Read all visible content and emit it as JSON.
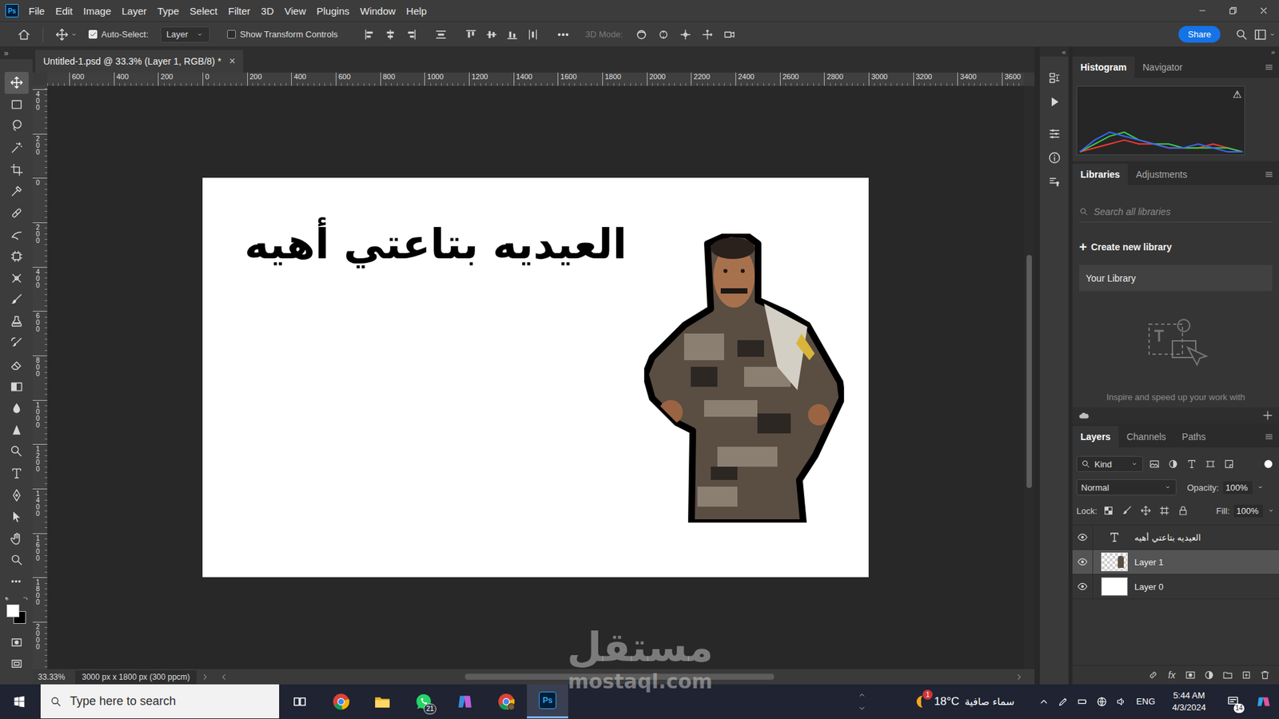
{
  "window": {
    "logo": "Ps",
    "controls": [
      {
        "kind": "minimize"
      },
      {
        "kind": "restore"
      },
      {
        "kind": "close"
      }
    ]
  },
  "menu": [
    "File",
    "Edit",
    "Image",
    "Layer",
    "Type",
    "Select",
    "Filter",
    "3D",
    "View",
    "Plugins",
    "Window",
    "Help"
  ],
  "options_bar": {
    "auto_select": {
      "label": "Auto-Select:",
      "checked": true
    },
    "target": "Layer",
    "transform_controls": {
      "label": "Show Transform Controls",
      "checked": false
    },
    "more": "•••",
    "mode_3d": {
      "label": "3D Mode:",
      "disabled": true
    },
    "share": "Share"
  },
  "document_tab": {
    "title": "Untitled-1.psd @ 33.3% (Layer 1, RGB/8) *",
    "close": "×"
  },
  "rulers": {
    "horizontal": [
      "600",
      "400",
      "200",
      "0",
      "200",
      "400",
      "600",
      "800",
      "1000",
      "1200",
      "1400",
      "1600",
      "1800",
      "2000",
      "2200",
      "2400",
      "2600",
      "2800",
      "3000",
      "3200",
      "3400",
      "3600"
    ],
    "vertical": [
      "400",
      "200",
      "0",
      "200",
      "400",
      "600",
      "800",
      "1000",
      "1200",
      "1400",
      "1600",
      "1800",
      "2000"
    ]
  },
  "scrollbars": {
    "vertical": {
      "offset": 0.29,
      "size": 0.4
    },
    "horizontal": {
      "offset": 0.3,
      "size": 0.4
    }
  },
  "toolbar": {
    "collapse": "»",
    "tools": [
      {
        "kind": "move",
        "selected": true
      },
      {
        "kind": "marquee",
        "selected": false
      },
      {
        "kind": "lasso",
        "selected": false
      },
      {
        "kind": "wand",
        "selected": false
      },
      {
        "kind": "crop",
        "selected": false
      },
      {
        "kind": "eyedropper",
        "selected": false
      },
      {
        "kind": "healing",
        "selected": false
      },
      {
        "kind": "patch",
        "selected": false
      },
      {
        "kind": "frame",
        "selected": false
      },
      {
        "kind": "content-move",
        "selected": false
      },
      {
        "kind": "brush",
        "selected": false
      },
      {
        "kind": "stamp",
        "selected": false
      },
      {
        "kind": "history-brush",
        "selected": false
      },
      {
        "kind": "eraser",
        "selected": false
      },
      {
        "kind": "gradient",
        "selected": false
      },
      {
        "kind": "smudge",
        "selected": false
      },
      {
        "kind": "sharpen",
        "selected": false
      },
      {
        "kind": "dodge",
        "selected": false
      },
      {
        "kind": "type",
        "selected": false
      },
      {
        "kind": "pen",
        "selected": false
      },
      {
        "kind": "path-select",
        "selected": false
      },
      {
        "kind": "hand",
        "selected": false
      },
      {
        "kind": "zoom",
        "selected": false
      }
    ],
    "more": "•••",
    "swatches": [
      {
        "kind": "foreground",
        "color": "#ffffff"
      },
      {
        "kind": "background",
        "color": "#000000"
      }
    ]
  },
  "canvas": {
    "text": "العيديه بتاعتي أهيه"
  },
  "side_column": {
    "collapse": "«"
  },
  "panels_collapse": "»",
  "histogram_panel": {
    "tabs": [
      {
        "label": "Histogram",
        "selected": true
      },
      {
        "label": "Navigator",
        "selected": false
      }
    ],
    "warning": "⚠",
    "series": [
      {
        "color": "#ff3535",
        "values": [
          0,
          1,
          2,
          3,
          2,
          2,
          1,
          1,
          1,
          2,
          1,
          0
        ]
      },
      {
        "color": "#35d045",
        "values": [
          0,
          2,
          4,
          5,
          3,
          2,
          2,
          1,
          1,
          1,
          1,
          0
        ]
      },
      {
        "color": "#3a66ff",
        "values": [
          0,
          3,
          5,
          4,
          3,
          2,
          1,
          1,
          2,
          1,
          0,
          0
        ]
      }
    ]
  },
  "libraries_panel": {
    "tabs": [
      {
        "label": "Libraries",
        "selected": true
      },
      {
        "label": "Adjustments",
        "selected": false
      }
    ],
    "search_placeholder": "Search all libraries",
    "create": {
      "icon": "+",
      "label": "Create new library"
    },
    "library": "Your Library",
    "hint": "Inspire and speed up your work with"
  },
  "layers_panel": {
    "tabs": [
      {
        "label": "Layers",
        "selected": true
      },
      {
        "label": "Channels",
        "selected": false
      },
      {
        "label": "Paths",
        "selected": false
      }
    ],
    "filter": "Kind",
    "filter_enabled": true,
    "blend_mode": "Normal",
    "opacity": {
      "label": "Opacity:",
      "value": "100%"
    },
    "lock_label": "Lock:",
    "fill": {
      "label": "Fill:",
      "value": "100%"
    },
    "layers": [
      {
        "name": "العيديه بتاعتي أهيه",
        "kind": "text",
        "visible": true,
        "selected": false
      },
      {
        "name": "Layer 1",
        "kind": "image",
        "visible": true,
        "selected": true
      },
      {
        "name": "Layer 0",
        "kind": "fill",
        "visible": true,
        "selected": false
      }
    ],
    "fx": "fx"
  },
  "status_bar": {
    "zoom": "33.33%",
    "document_info": "3000 px x 1800 px (300 ppcm)"
  },
  "taskbar": {
    "search_placeholder": "Type here to search",
    "apps": [
      {
        "kind": "task-view",
        "active": false
      },
      {
        "kind": "chrome",
        "active": false
      },
      {
        "kind": "explorer",
        "active": false
      },
      {
        "kind": "whatsapp",
        "active": false,
        "badge": "21"
      },
      {
        "kind": "copilot",
        "active": false
      },
      {
        "kind": "chrome-profile",
        "active": false
      },
      {
        "kind": "photoshop",
        "active": true,
        "label": "Ps"
      }
    ],
    "weather": {
      "badge": "1",
      "temperature": "18°C",
      "condition": "سماء صافية"
    },
    "language": "ENG",
    "time": "5:44 AM",
    "date": "4/3/2024",
    "notifications": "14"
  },
  "watermark": {
    "arabic": "مستقل",
    "latin": "mostaql.com"
  }
}
